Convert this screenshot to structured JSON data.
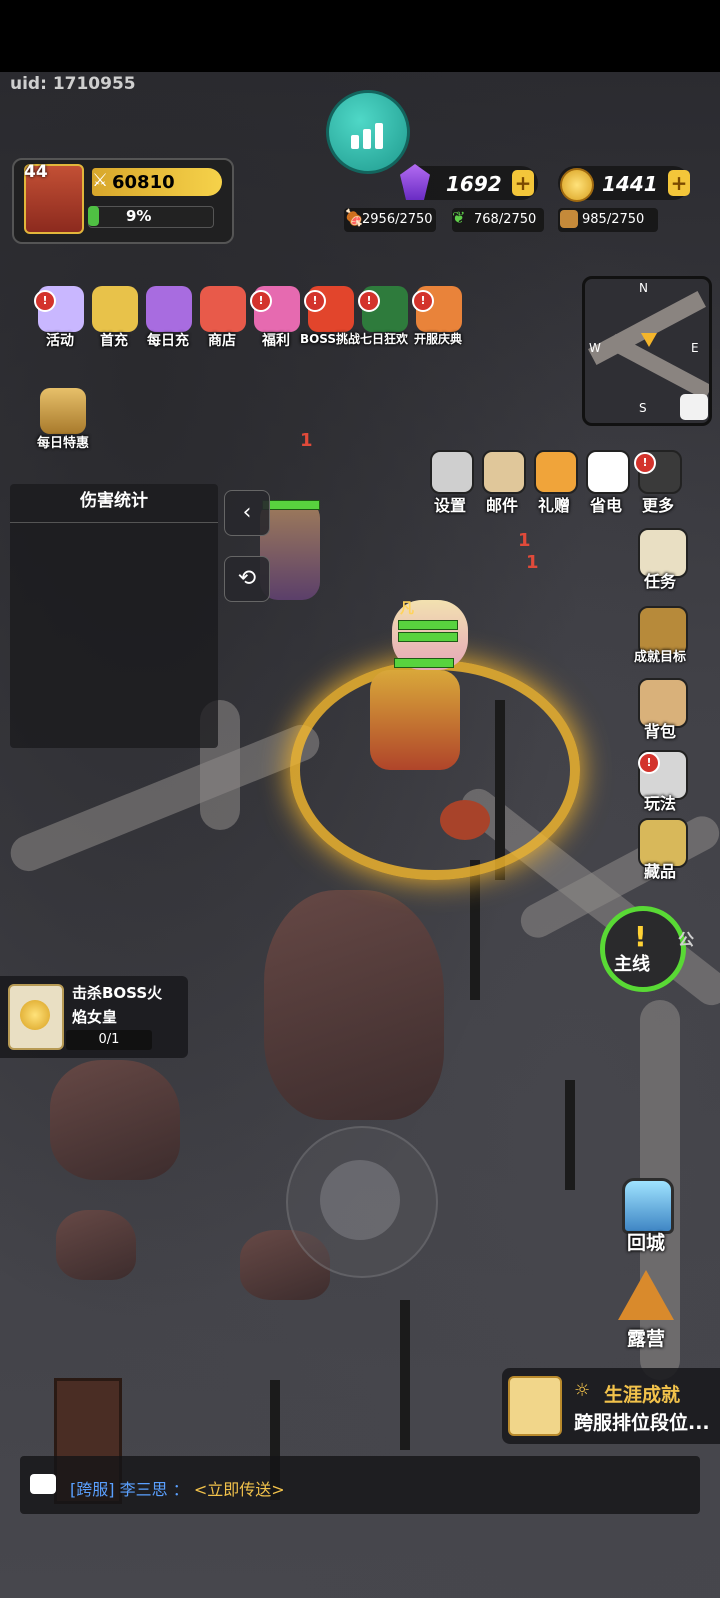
{
  "uid": "uid: 1710955",
  "player": {
    "level": "44",
    "power": "60810",
    "exp_percent": "9%",
    "exp_fraction": 0.09
  },
  "currencies": {
    "gems": "1692",
    "gold": "1441"
  },
  "resources": {
    "meat": "2956/2750",
    "herb": "768/2750",
    "wood": "985/2750"
  },
  "top_menu": [
    {
      "label": "活动",
      "badge": true
    },
    {
      "label": "首充",
      "badge": false
    },
    {
      "label": "每日充",
      "badge": false
    },
    {
      "label": "商店",
      "badge": false
    },
    {
      "label": "福利",
      "badge": true
    },
    {
      "label": "BOSS挑战",
      "badge": true
    },
    {
      "label": "七日狂欢",
      "badge": true
    },
    {
      "label": "开服庆典",
      "badge": true
    }
  ],
  "daily_deal": "每日特惠",
  "minimap": {
    "n": "N",
    "s": "S",
    "e": "E",
    "w": "W"
  },
  "utility_menu": [
    "设置",
    "邮件",
    "礼赠",
    "省电",
    "更多"
  ],
  "right_menu": [
    "任务",
    "成就目标",
    "背包",
    "玩法",
    "藏品"
  ],
  "damage_panel": {
    "title": "伤害统计"
  },
  "floating_numbers": [
    "1",
    "1",
    "1"
  ],
  "ally_name": "凡",
  "quest": {
    "title": "击杀BOSS火焰女皇",
    "line1": "击杀BOSS火",
    "line2": "焰女皇",
    "progress": "0/1"
  },
  "mainline": {
    "label": "主线",
    "side": "公"
  },
  "bottom_right": [
    {
      "label": "回城"
    },
    {
      "label": "露营"
    }
  ],
  "achievement": {
    "title": "生涯成就",
    "desc": "跨服排位段位..."
  },
  "chat": {
    "channel": "[跨服]",
    "user": "李三思",
    "sep": "：",
    "message": "<立即传送>"
  },
  "colors": {
    "exp_green": "#4fc043",
    "power_gold": "#f6d24a",
    "chat_channel": "#5aa0ff",
    "chat_message": "#f2c24b",
    "mainline_ring": "#59d935"
  }
}
